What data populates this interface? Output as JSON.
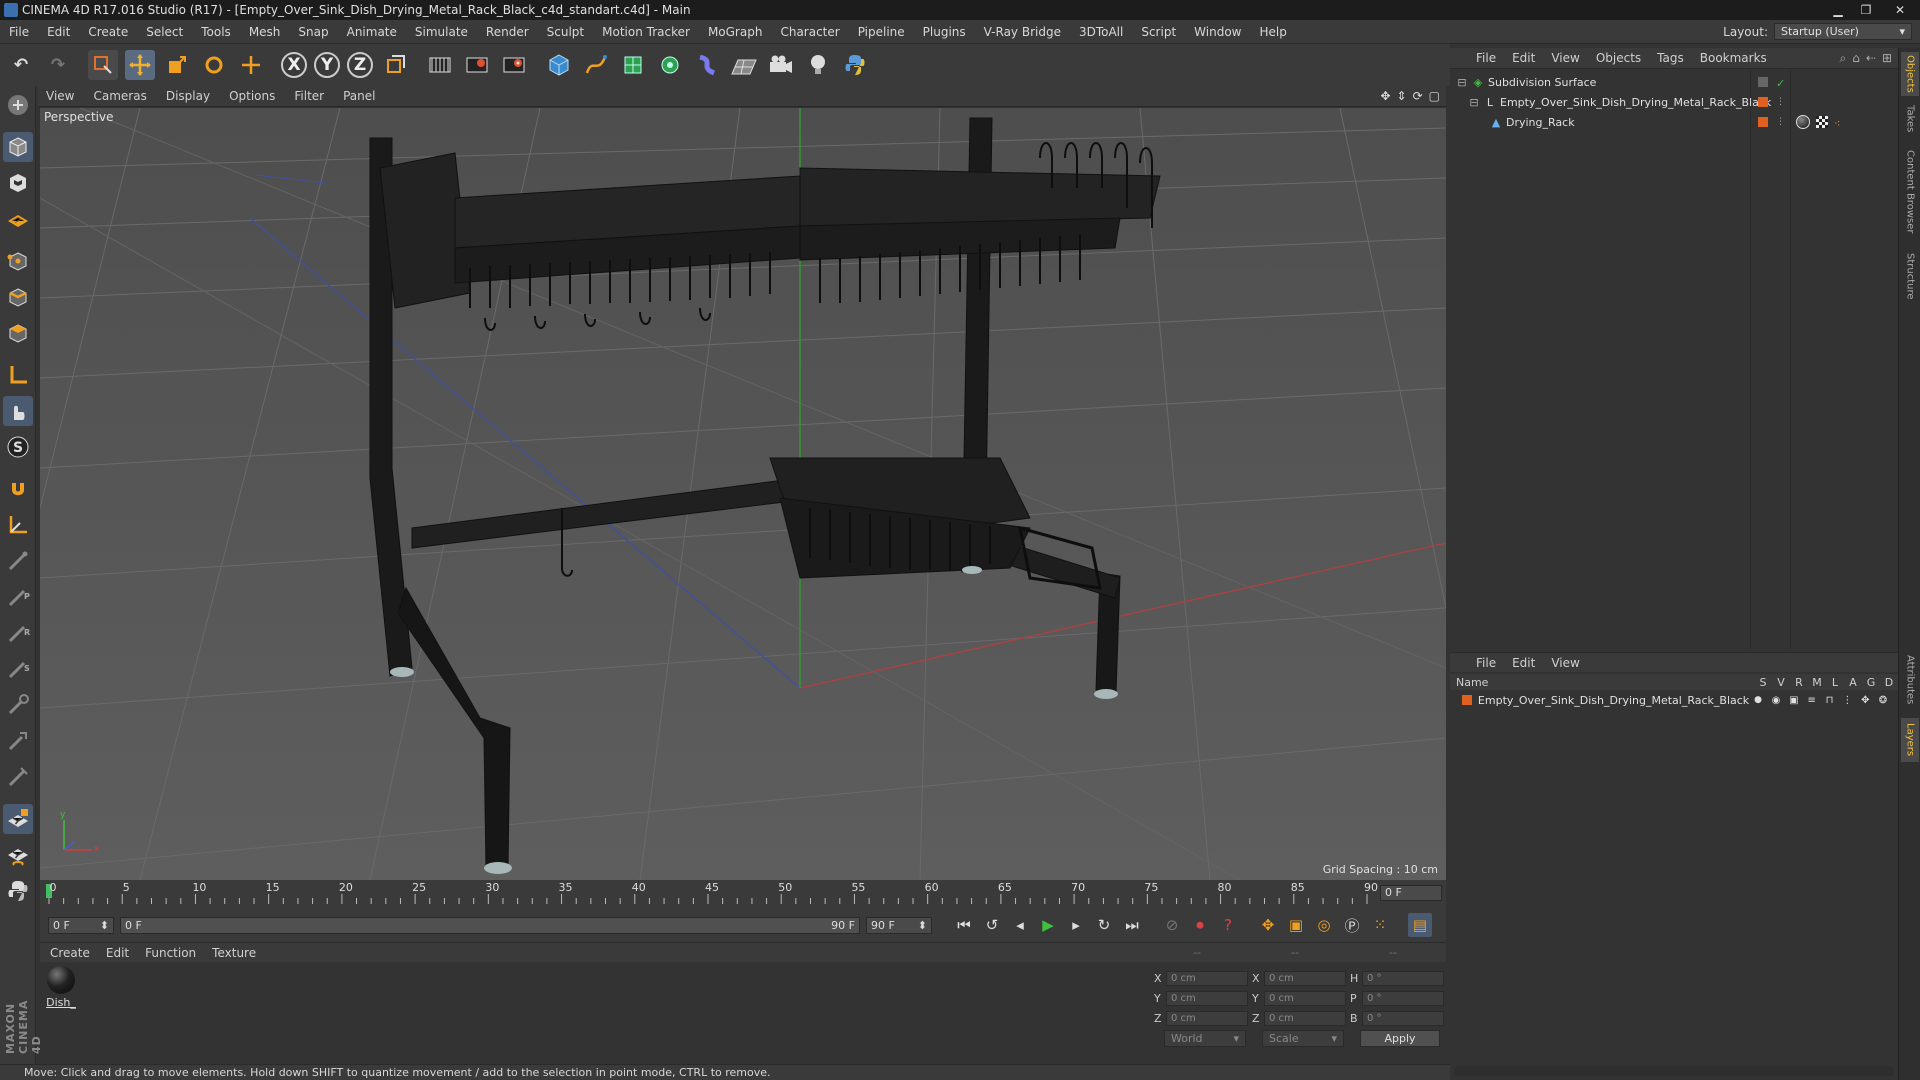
{
  "window": {
    "title": "CINEMA 4D R17.016 Studio (R17) - [Empty_Over_Sink_Dish_Drying_Metal_Rack_Black_c4d_standart.c4d] - Main",
    "minimize": "▁",
    "maximize": "❐",
    "close": "✕"
  },
  "menubar": {
    "items": [
      "File",
      "Edit",
      "Create",
      "Select",
      "Tools",
      "Mesh",
      "Snap",
      "Animate",
      "Simulate",
      "Render",
      "Sculpt",
      "Motion Tracker",
      "MoGraph",
      "Character",
      "Pipeline",
      "Plugins",
      "V-Ray Bridge",
      "3DToAll",
      "Script",
      "Window",
      "Help"
    ],
    "layout_label": "Layout:",
    "layout_value": "Startup (User)"
  },
  "toolbar": {
    "undo": "↶",
    "redo": "↷",
    "x_axis": "X",
    "y_axis": "Y",
    "z_axis": "Z"
  },
  "viewport": {
    "menu": [
      "View",
      "Cameras",
      "Display",
      "Options",
      "Filter",
      "Panel"
    ],
    "label": "Perspective",
    "grid_spacing": "Grid Spacing : 10 cm",
    "axis_x": "x",
    "axis_y": "y"
  },
  "timeline": {
    "ticks": [
      "0",
      "5",
      "10",
      "15",
      "20",
      "25",
      "30",
      "35",
      "40",
      "45",
      "50",
      "55",
      "60",
      "65",
      "70",
      "75",
      "80",
      "85",
      "90"
    ],
    "current_frame": "0 F"
  },
  "transport": {
    "start_frame": "0 F",
    "range_start": "0 F",
    "range_end": "90 F",
    "end_frame": "90 F"
  },
  "material_manager": {
    "menu": [
      "Create",
      "Edit",
      "Function",
      "Texture"
    ],
    "materials": [
      {
        "name": "Dish_"
      }
    ]
  },
  "coordinates": {
    "headers": [
      "--",
      "--",
      "--"
    ],
    "rows": [
      {
        "a": "X",
        "a_val": "0 cm",
        "b": "X",
        "b_val": "0 cm",
        "c": "H",
        "c_val": "0 °"
      },
      {
        "a": "Y",
        "a_val": "0 cm",
        "b": "Y",
        "b_val": "0 cm",
        "c": "P",
        "c_val": "0 °"
      },
      {
        "a": "Z",
        "a_val": "0 cm",
        "b": "Z",
        "b_val": "0 cm",
        "c": "B",
        "c_val": "0 °"
      }
    ],
    "world": "World",
    "scale": "Scale",
    "apply": "Apply"
  },
  "statusbar": {
    "text": "Move: Click and drag to move elements. Hold down SHIFT to quantize movement / add to the selection in point mode, CTRL to remove."
  },
  "object_manager": {
    "menu": [
      "File",
      "Edit",
      "View",
      "Objects",
      "Tags",
      "Bookmarks"
    ],
    "objects": [
      {
        "name": "Subdivision Surface",
        "icon": "subdivision-icon"
      },
      {
        "name": "Empty_Over_Sink_Dish_Drying_Metal_Rack_Black",
        "icon": "null-object-icon"
      },
      {
        "name": "Drying_Rack",
        "icon": "polygon-object-icon"
      }
    ]
  },
  "layer_manager": {
    "menu": [
      "File",
      "Edit",
      "View"
    ],
    "header_name": "Name",
    "columns": [
      "S",
      "V",
      "R",
      "M",
      "L",
      "A",
      "G",
      "D"
    ],
    "layers": [
      {
        "name": "Empty_Over_Sink_Dish_Drying_Metal_Rack_Black"
      }
    ]
  },
  "right_tabs": [
    "Objects",
    "Takes",
    "Content Browser",
    "Structure",
    "Attributes",
    "Layers"
  ],
  "brand": "MAXON CINEMA 4D",
  "colors": {
    "accent": "#f0a030",
    "layer_orange": "#e06020",
    "green": "#40c040"
  }
}
